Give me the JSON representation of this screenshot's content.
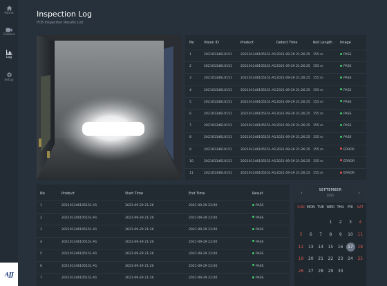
{
  "sidebar": {
    "items": [
      {
        "label": "Home",
        "icon": "home-icon"
      },
      {
        "label": "Camera",
        "icon": "camera-icon"
      },
      {
        "label": "Log",
        "icon": "chart-icon",
        "active": true
      },
      {
        "label": "Setup",
        "icon": "gear-icon"
      }
    ],
    "logo_text": "AJJ"
  },
  "header": {
    "title": "Inspection Log",
    "subtitle": "PCB Inspection Results List"
  },
  "inspection_table": {
    "columns": [
      "No",
      "Vision ID",
      "Product",
      "Detect Time",
      "Roll Length",
      "Image"
    ],
    "rows": [
      {
        "no": "1",
        "vision_id": "20210134610151",
        "product": "202101346105151-A1",
        "detect_time": "2021-09-29 21:26:25",
        "roll_length": "155 m",
        "status": "PASS"
      },
      {
        "no": "2",
        "vision_id": "20210134610151",
        "product": "202101346105151-A1",
        "detect_time": "2021-09-29 21:26:25",
        "roll_length": "155 m",
        "status": "PASS"
      },
      {
        "no": "3",
        "vision_id": "20210134610151",
        "product": "202101346105151-A1",
        "detect_time": "2021-09-29 21:26:25",
        "roll_length": "155 m",
        "status": "PASS"
      },
      {
        "no": "4",
        "vision_id": "20210134610151",
        "product": "202101346105151-A1",
        "detect_time": "2021-09-29 21:26:25",
        "roll_length": "155 m",
        "status": "PASS"
      },
      {
        "no": "5",
        "vision_id": "20210134610151",
        "product": "202101346105151-A1",
        "detect_time": "2021-09-29 21:26:25",
        "roll_length": "155 m",
        "status": "PASS"
      },
      {
        "no": "6",
        "vision_id": "20210134610151",
        "product": "202101346105151-A1",
        "detect_time": "2021-09-29 21:26:25",
        "roll_length": "155 m",
        "status": "PASS"
      },
      {
        "no": "7",
        "vision_id": "20210134610151",
        "product": "202101346105151-A1",
        "detect_time": "2021-09-29 21:26:25",
        "roll_length": "155 m",
        "status": "PASS"
      },
      {
        "no": "8",
        "vision_id": "20210134610151",
        "product": "202101346105151-A1",
        "detect_time": "2021-09-29 21:26:25",
        "roll_length": "155 m",
        "status": "PASS"
      },
      {
        "no": "9",
        "vision_id": "20210134610151",
        "product": "202101346105151-A1",
        "detect_time": "2021-09-29 21:26:25",
        "roll_length": "155 m",
        "status": "ERROR"
      },
      {
        "no": "10",
        "vision_id": "20210134610151",
        "product": "202101346105151-A1",
        "detect_time": "2021-09-29 21:26:25",
        "roll_length": "155 m",
        "status": "ERROR"
      },
      {
        "no": "11",
        "vision_id": "20210134610151",
        "product": "202101346105151-A1",
        "detect_time": "2021-09-29 21:26:25",
        "roll_length": "155 m",
        "status": "ERROR"
      }
    ]
  },
  "product_table": {
    "columns": [
      "No",
      "Product",
      "Start Time",
      "End Time",
      "Result"
    ],
    "rows": [
      {
        "no": "1",
        "product": "202101346105151-A1",
        "start_time": "2021-09-29 21:26",
        "end_time": "2021-09-29 22:00",
        "result": "PASS"
      },
      {
        "no": "2",
        "product": "202101346105151-A1",
        "start_time": "2021-09-29 21:26",
        "end_time": "2021-09-29 22:00",
        "result": "PASS"
      },
      {
        "no": "3",
        "product": "202101346105151-A1",
        "start_time": "2021-09-29 21:26",
        "end_time": "2021-09-29 22:00",
        "result": "PASS"
      },
      {
        "no": "4",
        "product": "202101346105151-A1",
        "start_time": "2021-09-29 21:26",
        "end_time": "2021-09-29 22:00",
        "result": "PASS"
      },
      {
        "no": "5",
        "product": "202101346105151-A1",
        "start_time": "2021-09-29 21:26",
        "end_time": "2021-09-29 22:00",
        "result": "PASS"
      },
      {
        "no": "6",
        "product": "202101346105151-A1",
        "start_time": "2021-09-29 21:26",
        "end_time": "2021-09-29 22:00",
        "result": "PASS"
      },
      {
        "no": "7",
        "product": "202101346105151-A1",
        "start_time": "2021-09-29 21:26",
        "end_time": "2021-09-29 22:00",
        "result": "PASS"
      }
    ]
  },
  "calendar": {
    "month": "SEPTEMBER",
    "year": "2021",
    "prev_icon": "chevron-left-icon",
    "next_icon": "chevron-right-icon",
    "weekdays": [
      "SUN",
      "MON",
      "TUE",
      "WED",
      "THU",
      "FRI",
      "SAT"
    ],
    "weeks": [
      [
        "",
        "",
        "",
        "1",
        "2",
        "3",
        "4"
      ],
      [
        "5",
        "6",
        "7",
        "8",
        "9",
        "10",
        "11"
      ],
      [
        "12",
        "13",
        "14",
        "15",
        "16",
        "17",
        "18"
      ],
      [
        "19",
        "20",
        "21",
        "22",
        "23",
        "24",
        "25"
      ],
      [
        "26",
        "27",
        "28",
        "29",
        "30",
        "",
        ""
      ]
    ],
    "selected_day": "17"
  },
  "colors": {
    "pass": "#3ecf6a",
    "error": "#e8524a",
    "weekend": "#d85a4e",
    "background": "#27313b"
  }
}
